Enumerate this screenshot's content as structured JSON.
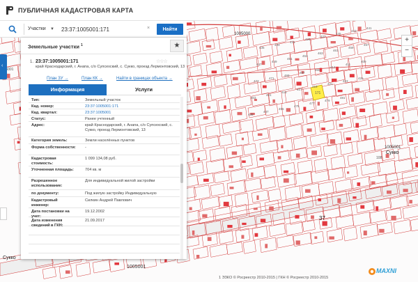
{
  "app": {
    "title": "ПУБЛИЧНАЯ КАДАСТРОВАЯ КАРТА"
  },
  "search": {
    "type_label": "Участки",
    "value": "23:37:1005001:171",
    "clear_symbol": "×",
    "button_label": "Найти"
  },
  "panel": {
    "title": "Земельные участки",
    "count": "1",
    "star_symbol": "★"
  },
  "result": {
    "index": "1.",
    "cad_number": "23:37:1005001:171",
    "rating_symbol": "☆☆☆",
    "address": "край Краснодарский, г. Анапа, с/о Супсехский, с. Сукко, проезд Лермонтовский, 13",
    "links": {
      "plan_zu": "План ЗУ →",
      "plan_kk": "План КК →",
      "in_bounds": "Найти в границах объекта →"
    }
  },
  "tabs": {
    "info": "Информация",
    "services": "Услуги"
  },
  "info_rows": [
    {
      "key": "Тип:",
      "value": "Земельный участок"
    },
    {
      "key": "Кад. номер:",
      "value": "23:37:1005001:171"
    },
    {
      "key": "Кад. квартал:",
      "value": "23:37:1005001"
    },
    {
      "key": "Статус:",
      "value": "Ранее учтенный"
    },
    {
      "key": "Адрес:",
      "value": "край Краснодарский, г. Анапа, с/о Супсехский, с. Сукко, проезд Лермонтовский, 13"
    },
    {
      "key": "Категория земель:",
      "value": "Земли населённых пунктов"
    },
    {
      "key": "Форма собственности:",
      "value": "-"
    },
    {
      "key": "Кадастровая стоимость:",
      "value": "1 099 134,08 руб."
    },
    {
      "key": "Уточненная площадь:",
      "value": "704 кв. м"
    },
    {
      "key": "Разрешенное использование:",
      "value": "Для индивидуальной жилой застройки"
    },
    {
      "key": "по документу:",
      "value": "Под жилую застройку Индивидуальную"
    },
    {
      "key": "Кадастровый инженер:",
      "value": "Силкин Андрей Павлович"
    },
    {
      "key": "Дата постановки на учет:",
      "value": "19.12.2002"
    },
    {
      "key": "Дата изменения сведений в ГКН:",
      "value": "21.09.2017"
    },
    {
      "key": "",
      "value": ""
    },
    {
      "key": "",
      "value": ""
    },
    {
      "key": "",
      "value": ""
    },
    {
      "key": "",
      "value": ""
    }
  ],
  "map": {
    "labels": {
      "quarter_top": "1005000",
      "quarter_right": "1005001",
      "quarter_bottom": "1005001",
      "village_right": "Сукко",
      "village_bottom_left": "Сукко",
      "zone_left": "1005001",
      "plot_37": "37",
      "plot_108": "108",
      "plot_171": "171"
    },
    "parcel_numbers": [
      "435",
      "433",
      "431",
      "429",
      "427",
      "445",
      "443",
      "441",
      "447",
      "449",
      "451",
      "453",
      "463",
      "461",
      "459",
      "457",
      "473",
      "471",
      "469",
      "467",
      "465",
      "413",
      "411",
      "409",
      "403",
      "401",
      "415",
      "417",
      "419",
      "421",
      "423",
      "425",
      "439",
      "437",
      "455",
      "475",
      "477",
      "479",
      "481"
    ],
    "colors": {
      "parcel_outline": "#d33a3a",
      "building_fill": "#e06a6a",
      "building_red": "#e2393f",
      "selected_fill": "#ffee4a",
      "road": "#e0e0e0"
    }
  },
  "zoom": {
    "in": "+",
    "out": "−"
  },
  "footer": {
    "copyright": "1 ЭЗКО © Росреестр 2010-2015 | ГКН © Росреестр 2010-2015"
  },
  "watermark": {
    "text": "MAXNI"
  }
}
